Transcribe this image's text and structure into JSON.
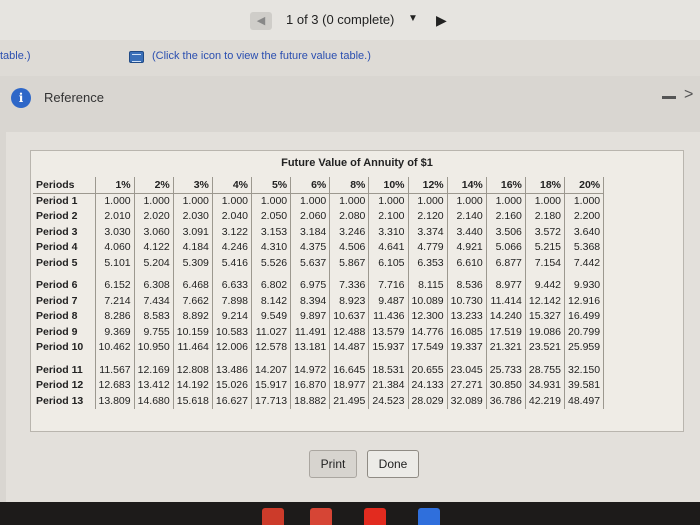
{
  "nav": {
    "status": "1 of 3 (0 complete)",
    "prev_icon": "left-arrow-icon",
    "caret_icon": "caret-down-icon",
    "next_icon": "right-arrow-icon"
  },
  "subbar": {
    "fragment": "table.)",
    "link_text": "(Click the icon to view the future value table.)"
  },
  "reference": {
    "title": "Reference"
  },
  "table": {
    "title": "Future Value of Annuity of $1",
    "headers": [
      "Periods",
      "1%",
      "2%",
      "3%",
      "4%",
      "5%",
      "6%",
      "8%",
      "10%",
      "12%",
      "14%",
      "16%",
      "18%",
      "20%"
    ],
    "rows": [
      [
        "Period 1",
        "1.000",
        "1.000",
        "1.000",
        "1.000",
        "1.000",
        "1.000",
        "1.000",
        "1.000",
        "1.000",
        "1.000",
        "1.000",
        "1.000",
        "1.000"
      ],
      [
        "Period 2",
        "2.010",
        "2.020",
        "2.030",
        "2.040",
        "2.050",
        "2.060",
        "2.080",
        "2.100",
        "2.120",
        "2.140",
        "2.160",
        "2.180",
        "2.200"
      ],
      [
        "Period 3",
        "3.030",
        "3.060",
        "3.091",
        "3.122",
        "3.153",
        "3.184",
        "3.246",
        "3.310",
        "3.374",
        "3.440",
        "3.506",
        "3.572",
        "3.640"
      ],
      [
        "Period 4",
        "4.060",
        "4.122",
        "4.184",
        "4.246",
        "4.310",
        "4.375",
        "4.506",
        "4.641",
        "4.779",
        "4.921",
        "5.066",
        "5.215",
        "5.368"
      ],
      [
        "Period 5",
        "5.101",
        "5.204",
        "5.309",
        "5.416",
        "5.526",
        "5.637",
        "5.867",
        "6.105",
        "6.353",
        "6.610",
        "6.877",
        "7.154",
        "7.442"
      ],
      [
        "Period 6",
        "6.152",
        "6.308",
        "6.468",
        "6.633",
        "6.802",
        "6.975",
        "7.336",
        "7.716",
        "8.115",
        "8.536",
        "8.977",
        "9.442",
        "9.930"
      ],
      [
        "Period 7",
        "7.214",
        "7.434",
        "7.662",
        "7.898",
        "8.142",
        "8.394",
        "8.923",
        "9.487",
        "10.089",
        "10.730",
        "11.414",
        "12.142",
        "12.916"
      ],
      [
        "Period 8",
        "8.286",
        "8.583",
        "8.892",
        "9.214",
        "9.549",
        "9.897",
        "10.637",
        "11.436",
        "12.300",
        "13.233",
        "14.240",
        "15.327",
        "16.499"
      ],
      [
        "Period 9",
        "9.369",
        "9.755",
        "10.159",
        "10.583",
        "11.027",
        "11.491",
        "12.488",
        "13.579",
        "14.776",
        "16.085",
        "17.519",
        "19.086",
        "20.799"
      ],
      [
        "Period 10",
        "10.462",
        "10.950",
        "11.464",
        "12.006",
        "12.578",
        "13.181",
        "14.487",
        "15.937",
        "17.549",
        "19.337",
        "21.321",
        "23.521",
        "25.959"
      ],
      [
        "Period 11",
        "11.567",
        "12.169",
        "12.808",
        "13.486",
        "14.207",
        "14.972",
        "16.645",
        "18.531",
        "20.655",
        "23.045",
        "25.733",
        "28.755",
        "32.150"
      ],
      [
        "Period 12",
        "12.683",
        "13.412",
        "14.192",
        "15.026",
        "15.917",
        "16.870",
        "18.977",
        "21.384",
        "24.133",
        "27.271",
        "30.850",
        "34.931",
        "39.581"
      ],
      [
        "Period 13",
        "13.809",
        "14.680",
        "15.618",
        "16.627",
        "17.713",
        "18.882",
        "21.495",
        "24.523",
        "28.029",
        "32.089",
        "36.786",
        "42.219",
        "48.497"
      ]
    ]
  },
  "buttons": {
    "print": "Print",
    "done": "Done"
  },
  "taskbar": {
    "icons": [
      "chrome-icon",
      "gmail-icon",
      "youtube-icon",
      "docs-icon"
    ]
  }
}
